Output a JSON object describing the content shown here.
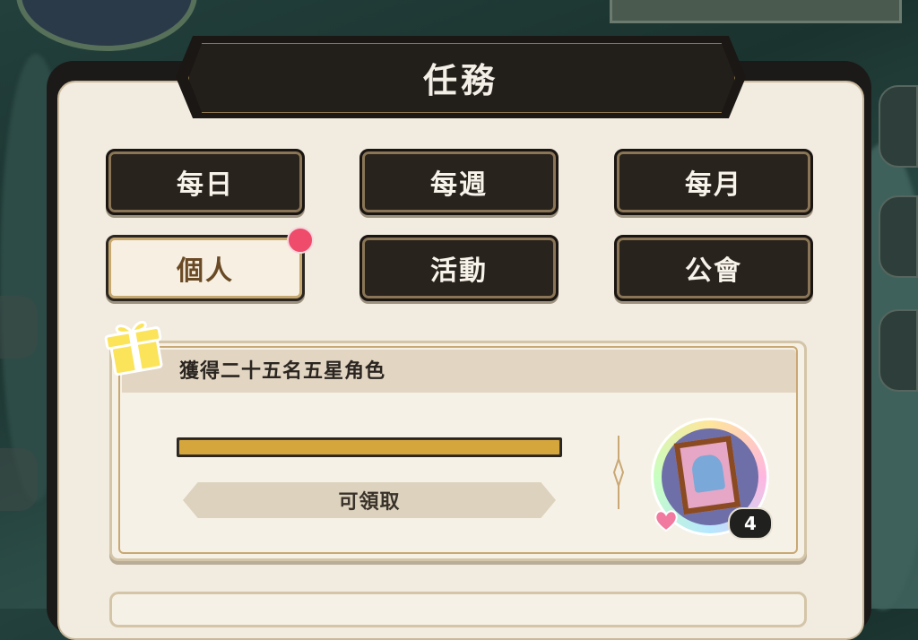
{
  "window": {
    "title": "任務"
  },
  "tabs": [
    {
      "label": "每日",
      "active": false
    },
    {
      "label": "每週",
      "active": false
    },
    {
      "label": "每月",
      "active": false
    },
    {
      "label": "個人",
      "active": true,
      "has_notification": true
    },
    {
      "label": "活動",
      "active": false
    },
    {
      "label": "公會",
      "active": false
    }
  ],
  "quest": {
    "title": "獲得二十五名五星角色",
    "progress": 1.0,
    "claim_label": "可領取",
    "reward": {
      "icon": "character-portrait-frame-icon",
      "count": "4"
    }
  },
  "colors": {
    "accent_gold": "#d5a63c",
    "notification": "#ef4b6b",
    "active_tab_text": "#6a4a25"
  }
}
